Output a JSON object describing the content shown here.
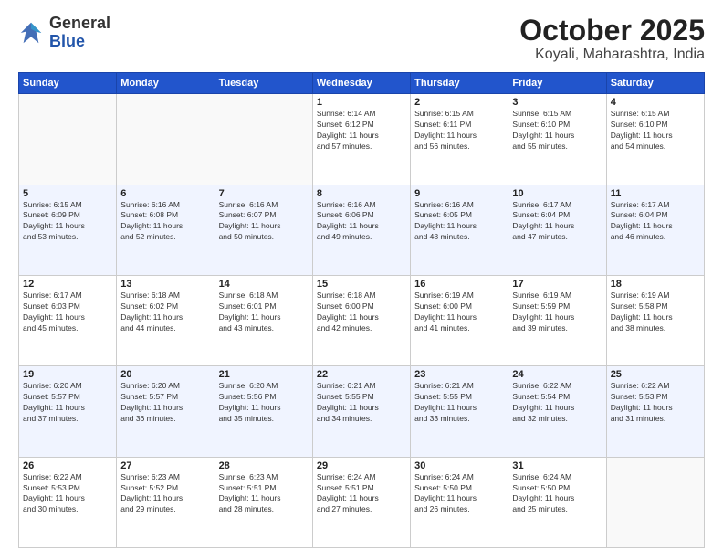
{
  "header": {
    "logo_general": "General",
    "logo_blue": "Blue",
    "month": "October 2025",
    "location": "Koyali, Maharashtra, India"
  },
  "weekdays": [
    "Sunday",
    "Monday",
    "Tuesday",
    "Wednesday",
    "Thursday",
    "Friday",
    "Saturday"
  ],
  "weeks": [
    {
      "alt": false,
      "days": [
        {
          "num": "",
          "info": ""
        },
        {
          "num": "",
          "info": ""
        },
        {
          "num": "",
          "info": ""
        },
        {
          "num": "1",
          "info": "Sunrise: 6:14 AM\nSunset: 6:12 PM\nDaylight: 11 hours\nand 57 minutes."
        },
        {
          "num": "2",
          "info": "Sunrise: 6:15 AM\nSunset: 6:11 PM\nDaylight: 11 hours\nand 56 minutes."
        },
        {
          "num": "3",
          "info": "Sunrise: 6:15 AM\nSunset: 6:10 PM\nDaylight: 11 hours\nand 55 minutes."
        },
        {
          "num": "4",
          "info": "Sunrise: 6:15 AM\nSunset: 6:10 PM\nDaylight: 11 hours\nand 54 minutes."
        }
      ]
    },
    {
      "alt": true,
      "days": [
        {
          "num": "5",
          "info": "Sunrise: 6:15 AM\nSunset: 6:09 PM\nDaylight: 11 hours\nand 53 minutes."
        },
        {
          "num": "6",
          "info": "Sunrise: 6:16 AM\nSunset: 6:08 PM\nDaylight: 11 hours\nand 52 minutes."
        },
        {
          "num": "7",
          "info": "Sunrise: 6:16 AM\nSunset: 6:07 PM\nDaylight: 11 hours\nand 50 minutes."
        },
        {
          "num": "8",
          "info": "Sunrise: 6:16 AM\nSunset: 6:06 PM\nDaylight: 11 hours\nand 49 minutes."
        },
        {
          "num": "9",
          "info": "Sunrise: 6:16 AM\nSunset: 6:05 PM\nDaylight: 11 hours\nand 48 minutes."
        },
        {
          "num": "10",
          "info": "Sunrise: 6:17 AM\nSunset: 6:04 PM\nDaylight: 11 hours\nand 47 minutes."
        },
        {
          "num": "11",
          "info": "Sunrise: 6:17 AM\nSunset: 6:04 PM\nDaylight: 11 hours\nand 46 minutes."
        }
      ]
    },
    {
      "alt": false,
      "days": [
        {
          "num": "12",
          "info": "Sunrise: 6:17 AM\nSunset: 6:03 PM\nDaylight: 11 hours\nand 45 minutes."
        },
        {
          "num": "13",
          "info": "Sunrise: 6:18 AM\nSunset: 6:02 PM\nDaylight: 11 hours\nand 44 minutes."
        },
        {
          "num": "14",
          "info": "Sunrise: 6:18 AM\nSunset: 6:01 PM\nDaylight: 11 hours\nand 43 minutes."
        },
        {
          "num": "15",
          "info": "Sunrise: 6:18 AM\nSunset: 6:00 PM\nDaylight: 11 hours\nand 42 minutes."
        },
        {
          "num": "16",
          "info": "Sunrise: 6:19 AM\nSunset: 6:00 PM\nDaylight: 11 hours\nand 41 minutes."
        },
        {
          "num": "17",
          "info": "Sunrise: 6:19 AM\nSunset: 5:59 PM\nDaylight: 11 hours\nand 39 minutes."
        },
        {
          "num": "18",
          "info": "Sunrise: 6:19 AM\nSunset: 5:58 PM\nDaylight: 11 hours\nand 38 minutes."
        }
      ]
    },
    {
      "alt": true,
      "days": [
        {
          "num": "19",
          "info": "Sunrise: 6:20 AM\nSunset: 5:57 PM\nDaylight: 11 hours\nand 37 minutes."
        },
        {
          "num": "20",
          "info": "Sunrise: 6:20 AM\nSunset: 5:57 PM\nDaylight: 11 hours\nand 36 minutes."
        },
        {
          "num": "21",
          "info": "Sunrise: 6:20 AM\nSunset: 5:56 PM\nDaylight: 11 hours\nand 35 minutes."
        },
        {
          "num": "22",
          "info": "Sunrise: 6:21 AM\nSunset: 5:55 PM\nDaylight: 11 hours\nand 34 minutes."
        },
        {
          "num": "23",
          "info": "Sunrise: 6:21 AM\nSunset: 5:55 PM\nDaylight: 11 hours\nand 33 minutes."
        },
        {
          "num": "24",
          "info": "Sunrise: 6:22 AM\nSunset: 5:54 PM\nDaylight: 11 hours\nand 32 minutes."
        },
        {
          "num": "25",
          "info": "Sunrise: 6:22 AM\nSunset: 5:53 PM\nDaylight: 11 hours\nand 31 minutes."
        }
      ]
    },
    {
      "alt": false,
      "days": [
        {
          "num": "26",
          "info": "Sunrise: 6:22 AM\nSunset: 5:53 PM\nDaylight: 11 hours\nand 30 minutes."
        },
        {
          "num": "27",
          "info": "Sunrise: 6:23 AM\nSunset: 5:52 PM\nDaylight: 11 hours\nand 29 minutes."
        },
        {
          "num": "28",
          "info": "Sunrise: 6:23 AM\nSunset: 5:51 PM\nDaylight: 11 hours\nand 28 minutes."
        },
        {
          "num": "29",
          "info": "Sunrise: 6:24 AM\nSunset: 5:51 PM\nDaylight: 11 hours\nand 27 minutes."
        },
        {
          "num": "30",
          "info": "Sunrise: 6:24 AM\nSunset: 5:50 PM\nDaylight: 11 hours\nand 26 minutes."
        },
        {
          "num": "31",
          "info": "Sunrise: 6:24 AM\nSunset: 5:50 PM\nDaylight: 11 hours\nand 25 minutes."
        },
        {
          "num": "",
          "info": ""
        }
      ]
    }
  ]
}
